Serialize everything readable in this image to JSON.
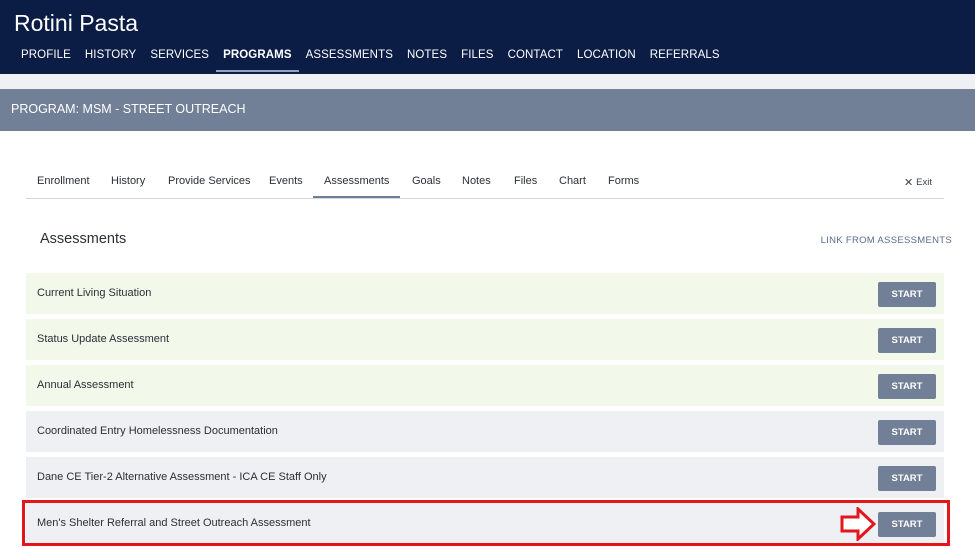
{
  "client": {
    "name": "Rotini Pasta"
  },
  "topnav": [
    {
      "label": "PROFILE",
      "active": false
    },
    {
      "label": "HISTORY",
      "active": false
    },
    {
      "label": "SERVICES",
      "active": false
    },
    {
      "label": "PROGRAMS",
      "active": true
    },
    {
      "label": "ASSESSMENTS",
      "active": false
    },
    {
      "label": "NOTES",
      "active": false
    },
    {
      "label": "FILES",
      "active": false
    },
    {
      "label": "CONTACT",
      "active": false
    },
    {
      "label": "LOCATION",
      "active": false
    },
    {
      "label": "REFERRALS",
      "active": false
    }
  ],
  "program": {
    "title": "PROGRAM: MSM - STREET OUTREACH"
  },
  "subtabs": [
    {
      "label": "Enrollment",
      "active": false
    },
    {
      "label": "History",
      "active": false
    },
    {
      "label": "Provide Services",
      "active": false
    },
    {
      "label": "Events",
      "active": false
    },
    {
      "label": "Assessments",
      "active": true
    },
    {
      "label": "Goals",
      "active": false
    },
    {
      "label": "Notes",
      "active": false
    },
    {
      "label": "Files",
      "active": false
    },
    {
      "label": "Chart",
      "active": false
    },
    {
      "label": "Forms",
      "active": false
    }
  ],
  "exit": {
    "label": "Exit",
    "icon": "close-icon"
  },
  "section": {
    "title": "Assessments",
    "link_label": "LINK FROM ASSESSMENTS"
  },
  "assessments": [
    {
      "name": "Current Living Situation",
      "button": "START",
      "tint": "green"
    },
    {
      "name": "Status Update Assessment",
      "button": "START",
      "tint": "green"
    },
    {
      "name": "Annual Assessment",
      "button": "START",
      "tint": "green"
    },
    {
      "name": "Coordinated Entry Homelessness Documentation",
      "button": "START",
      "tint": "grey"
    },
    {
      "name": "Dane CE Tier-2 Alternative Assessment - ICA CE Staff Only",
      "button": "START",
      "tint": "grey"
    },
    {
      "name": "Men's Shelter Referral and Street Outreach Assessment",
      "button": "START",
      "tint": "grey"
    }
  ],
  "colors": {
    "header_bg": "#0b1c45",
    "program_bar_bg": "#717f97",
    "button_bg": "#717f97",
    "row_green": "#f2f8ea",
    "row_grey": "#eef0f3",
    "annotation_red": "#e3161d"
  }
}
